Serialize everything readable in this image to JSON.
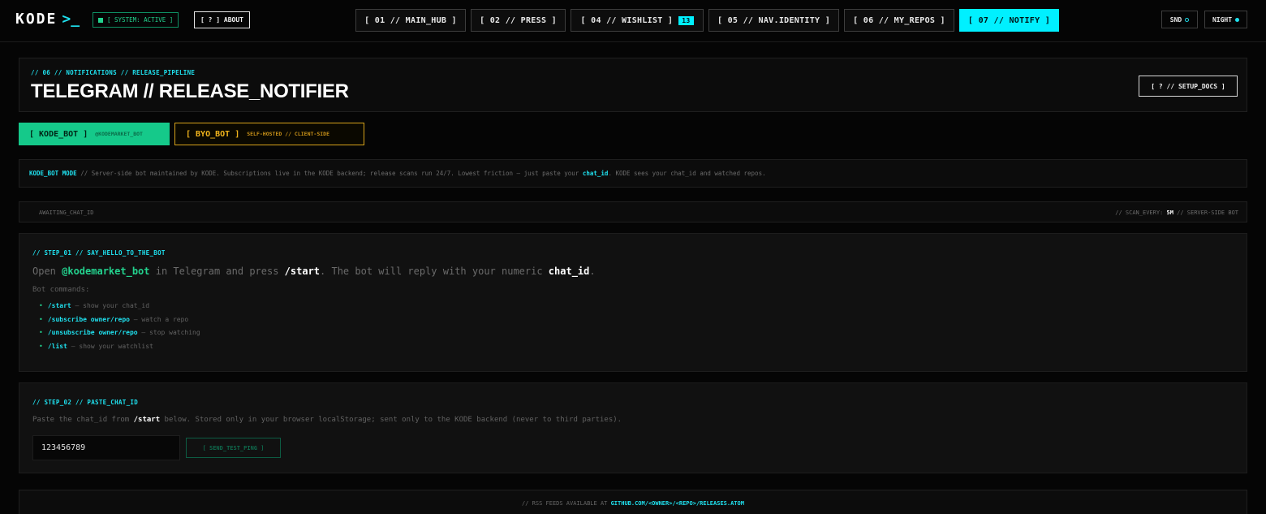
{
  "topbar": {
    "logo": "KODE",
    "prompt": ">_",
    "system_status": "[ SYSTEM: ACTIVE ]",
    "about": "[ ? ] ABOUT",
    "nav": [
      {
        "label": "[ 01 // MAIN_HUB ]",
        "active": false
      },
      {
        "label": "[ 02 // PRESS ]",
        "active": false
      },
      {
        "label": "[ 04 // WISHLIST ]",
        "count": "13",
        "active": false
      },
      {
        "label": "[ 05 // NAV.IDENTITY ]",
        "active": false
      },
      {
        "label": "[ 06 // MY_REPOS ]",
        "active": false
      },
      {
        "label": "[ 07 // NOTIFY ]",
        "active": true
      }
    ],
    "sound": "SND",
    "theme": "NIGHT"
  },
  "header": {
    "breadcrumb": "// 06 // NOTIFICATIONS // RELEASE_PIPELINE",
    "title": "TELEGRAM // RELEASE_NOTIFIER",
    "setup_docs": "[ ? // SETUP_DOCS ]"
  },
  "modes": {
    "kode": {
      "label": "[ KODE_BOT ]",
      "sub": "@KODEMARKET_BOT",
      "active": true
    },
    "byo": {
      "label": "[ BYO_BOT ]",
      "sub": "SELF-HOSTED // CLIENT-SIDE",
      "active": false
    }
  },
  "mode_info": {
    "name": "KODE_BOT MODE",
    "text_1": " // Server-side bot maintained by KODE. Subscriptions live in the KODE backend; release scans run 24/7. Lowest friction — just paste your ",
    "chat_id": "chat_id",
    "text_2": ". KODE sees your chat_id and watched repos."
  },
  "status": {
    "left": "AWAITING_CHAT_ID",
    "right_prefix": "// SCAN_EVERY: ",
    "interval": "5M",
    "right_suffix": " // SERVER-SIDE BOT"
  },
  "step1": {
    "title": "// STEP_01 // SAY_HELLO_TO_THE_BOT",
    "lead_1": "Open ",
    "bot_handle": "@kodemarket_bot",
    "lead_2": " in Telegram and press ",
    "start_cmd": "/start",
    "lead_3": ". The bot will reply with your numeric ",
    "chat_id": "chat_id",
    "lead_4": ".",
    "commands_label": "Bot commands:",
    "commands": [
      {
        "cmd": "/start",
        "desc": " — show your chat_id"
      },
      {
        "cmd": "/subscribe owner/repo",
        "desc": " — watch a repo"
      },
      {
        "cmd": "/unsubscribe owner/repo",
        "desc": " — stop watching"
      },
      {
        "cmd": "/list",
        "desc": " — show your watchlist"
      }
    ]
  },
  "step2": {
    "title": "// STEP_02 // PASTE_CHAT_ID",
    "text_1": "Paste the chat_id from ",
    "start_cmd": "/start",
    "text_2": " below. Stored only in your browser localStorage; sent only to the KODE backend (never to third parties).",
    "chat_id_value": "123456789",
    "ping_button": "[ SEND_TEST_PING ]"
  },
  "footer": {
    "prefix": "// RSS FEEDS AVAILABLE AT ",
    "url": "GITHUB.COM/<OWNER>/<REPO>/RELEASES.ATOM"
  },
  "colors": {
    "accent_cyan": "#00f0ff",
    "accent_green": "#15c98a",
    "accent_amber": "#f1b41c",
    "background": "#050505"
  }
}
